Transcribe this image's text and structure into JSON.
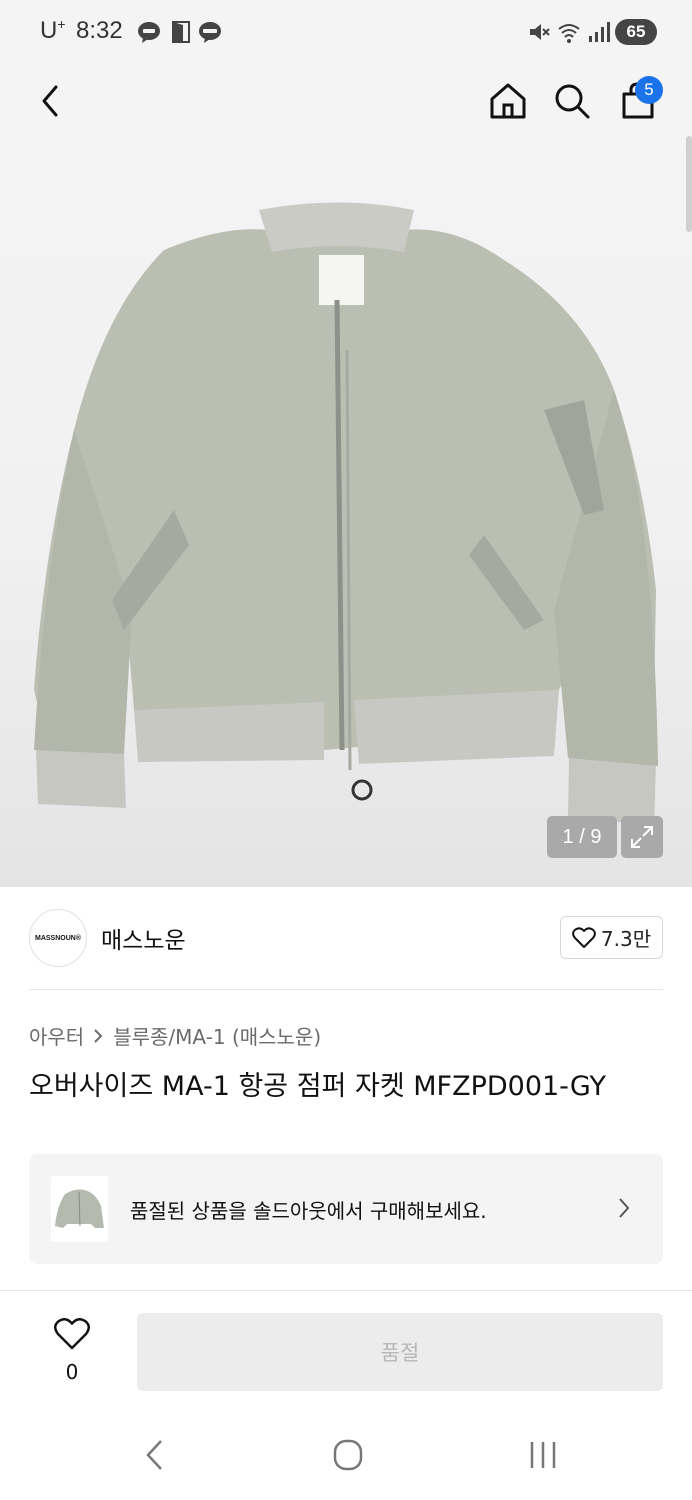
{
  "status_bar": {
    "carrier": "U",
    "carrier_sup": "+",
    "time": "8:32",
    "battery": "65"
  },
  "header": {
    "cart_count": "5"
  },
  "gallery": {
    "counter": "1 / 9"
  },
  "brand": {
    "logo_text": "MASSNOUN®",
    "name": "매스노운",
    "likes": "7.3만"
  },
  "breadcrumb": {
    "category": "아우터",
    "subcategory": "블루종/MA-1 (매스노운)"
  },
  "product": {
    "title": "오버사이즈 MA-1 항공 점퍼 자켓 MFZPD001-GY"
  },
  "soldout_banner": {
    "text": "품절된 상품을 솔드아웃에서 구매해보세요."
  },
  "bottom_bar": {
    "wish_count": "0",
    "buy_button_label": "품절"
  },
  "colors": {
    "badge": "#1a73e8",
    "jacket": "#b9bdb0",
    "disabled_button": "#ececec"
  }
}
